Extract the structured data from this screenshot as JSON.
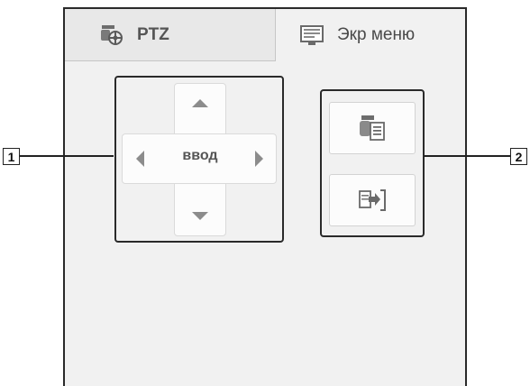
{
  "tabs": [
    {
      "label": "PTZ",
      "icon": "ptz-camera-icon",
      "active": true
    },
    {
      "label": "Экр меню",
      "icon": "screen-menu-icon",
      "active": false
    }
  ],
  "dpad": {
    "enter_label": "ввод",
    "arrows": [
      "up-arrow-icon",
      "down-arrow-icon",
      "left-arrow-icon",
      "right-arrow-icon"
    ]
  },
  "actions": [
    {
      "icon": "camera-list-icon"
    },
    {
      "icon": "exit-icon"
    }
  ],
  "callouts": [
    "1",
    "2"
  ],
  "colors": {
    "border": "#2a2a2a",
    "panel_bg": "#f1f1f1",
    "button_bg": "#fcfcfc",
    "arrow": "#8c8c8c"
  }
}
